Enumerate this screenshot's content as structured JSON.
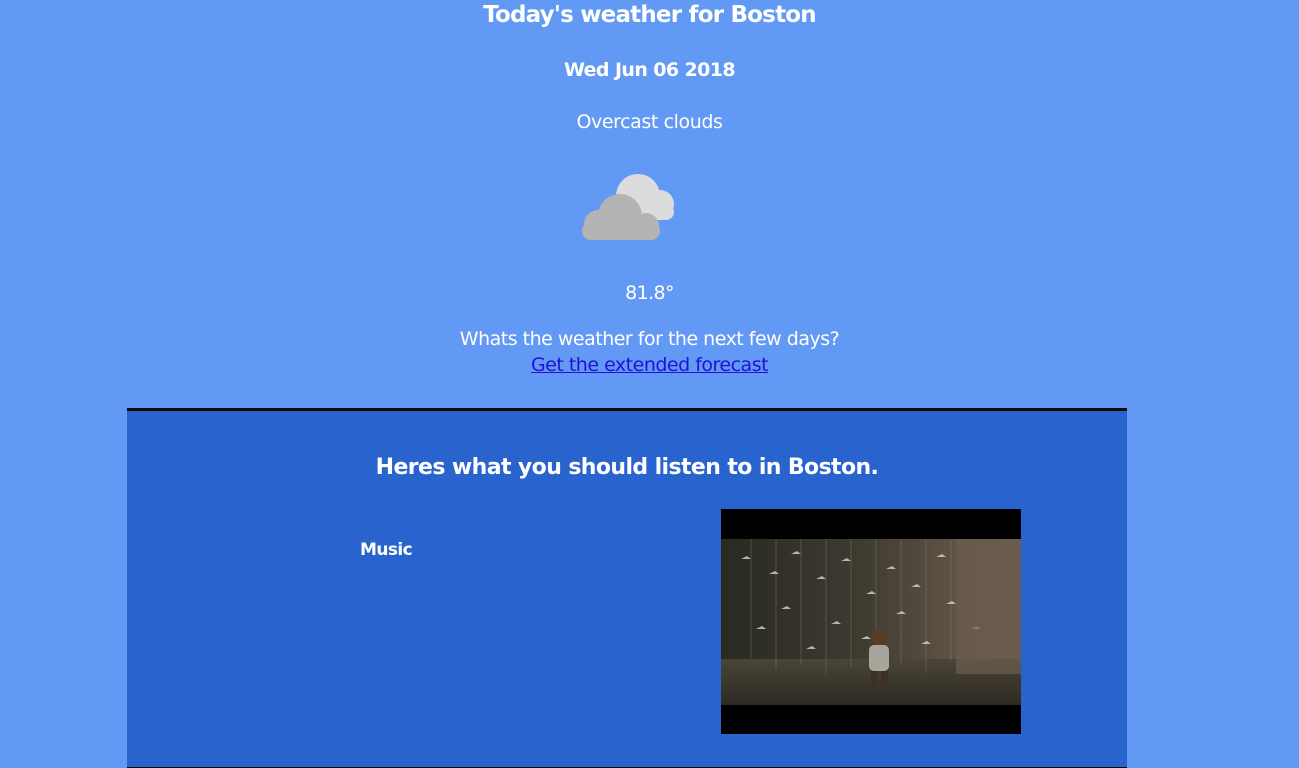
{
  "weather": {
    "title": "Today's weather for Boston",
    "date": "Wed Jun 06 2018",
    "description": "Overcast clouds",
    "icon": "overcast-cloud-icon",
    "temperature": "81.8°",
    "question": "Whats the weather for the next few days?",
    "forecast_link": "Get the extended forecast"
  },
  "music": {
    "heading": "Heres what you should listen to in Boston.",
    "label": "Music"
  },
  "colors": {
    "page_background": "#6299f4",
    "panel_background": "#2963cd",
    "link": "#2310d8",
    "cloud_light": "#dcdcdc",
    "cloud_dark": "#b4b4b4"
  }
}
